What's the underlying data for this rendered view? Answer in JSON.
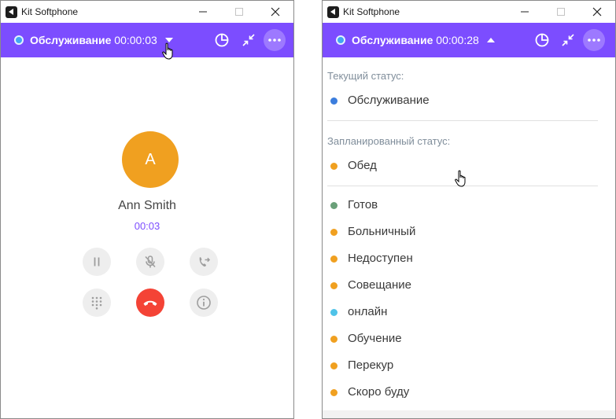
{
  "window_title": "Kit Softphone",
  "left_window": {
    "header": {
      "status": "Обслуживание",
      "timer": "00:00:03"
    },
    "call": {
      "avatar_letter": "A",
      "contact_name": "Ann Smith",
      "duration": "00:03"
    }
  },
  "right_window": {
    "header": {
      "status": "Обслуживание",
      "timer": "00:00:28"
    },
    "current_status_label": "Текущий статус:",
    "current_status": {
      "label": "Обслуживание",
      "color": "#3b7ddd"
    },
    "planned_status_label": "Запланированный статус:",
    "planned_status": {
      "label": "Обед",
      "color": "#f0a020"
    },
    "statuses": [
      {
        "label": "Готов",
        "color": "#6aa079"
      },
      {
        "label": "Больничный",
        "color": "#f0a020"
      },
      {
        "label": "Недоступен",
        "color": "#f0a020"
      },
      {
        "label": "Совещание",
        "color": "#f0a020"
      },
      {
        "label": "онлайн",
        "color": "#4fc3e8"
      },
      {
        "label": "Обучение",
        "color": "#f0a020"
      },
      {
        "label": "Перекур",
        "color": "#f0a020"
      },
      {
        "label": "Скоро буду",
        "color": "#f0a020"
      }
    ]
  },
  "colors": {
    "accent": "#7c4dff",
    "hangup": "#f44336",
    "avatar": "#f0a020"
  }
}
